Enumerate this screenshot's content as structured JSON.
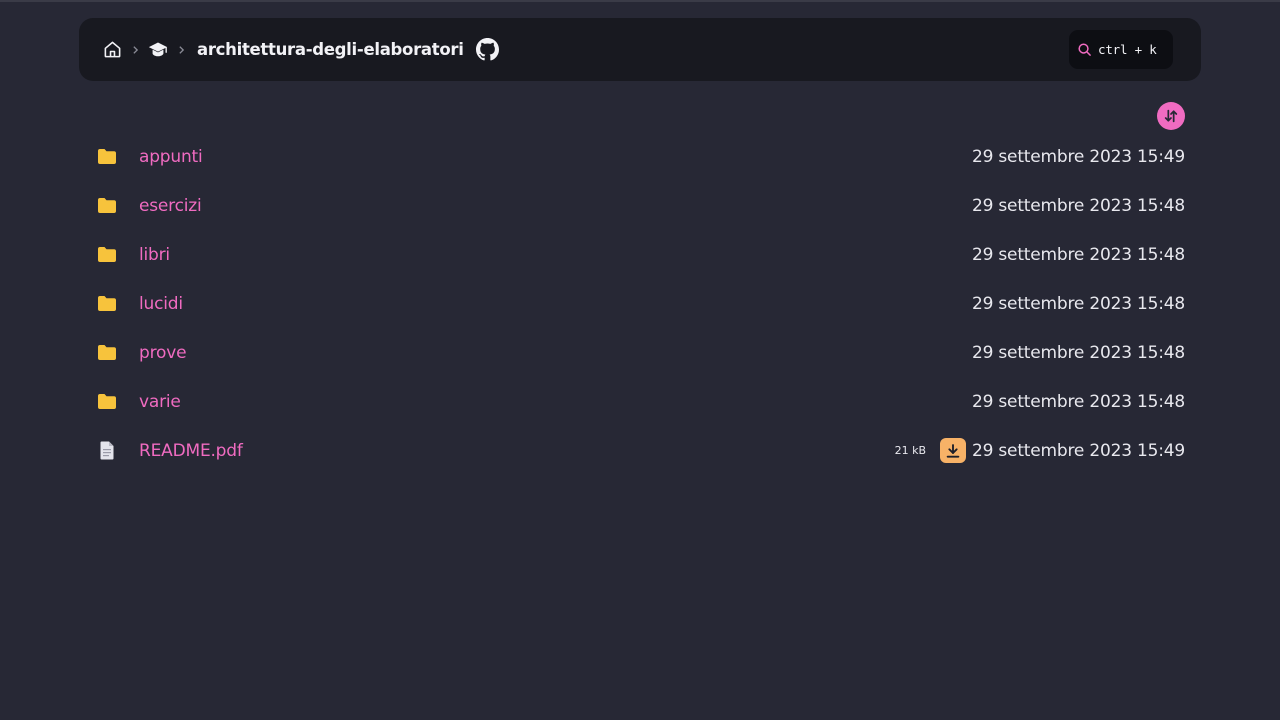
{
  "header": {
    "title": "architettura-degli-elaboratori",
    "search_shortcut": "ctrl + k",
    "icons": {
      "home": "home-icon",
      "course": "graduation-cap-icon",
      "repo": "github-icon",
      "search": "search-icon"
    }
  },
  "toolbar": {
    "sort_icon": "sort-arrows-icon"
  },
  "colors": {
    "background": "#272835",
    "header_bg": "#181920",
    "link": "#f06bc1",
    "folder": "#f7c33c",
    "download": "#f7b267"
  },
  "entries": [
    {
      "type": "folder",
      "name": "appunti",
      "date": "29 settembre 2023 15:49"
    },
    {
      "type": "folder",
      "name": "esercizi",
      "date": "29 settembre 2023 15:48"
    },
    {
      "type": "folder",
      "name": "libri",
      "date": "29 settembre 2023 15:48"
    },
    {
      "type": "folder",
      "name": "lucidi",
      "date": "29 settembre 2023 15:48"
    },
    {
      "type": "folder",
      "name": "prove",
      "date": "29 settembre 2023 15:48"
    },
    {
      "type": "folder",
      "name": "varie",
      "date": "29 settembre 2023 15:48"
    },
    {
      "type": "file",
      "name": "README.pdf",
      "size": "21 kB",
      "date": "29 settembre 2023 15:49"
    }
  ]
}
